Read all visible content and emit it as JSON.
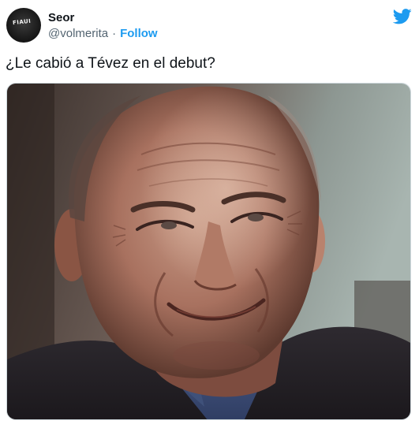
{
  "tweet": {
    "author": {
      "display_name": "Seor",
      "handle": "@volmerita",
      "avatar_text": "FIAUI"
    },
    "separator": "·",
    "follow_label": "Follow",
    "text": "¿Le cabió a Tévez en el debut?",
    "media": {
      "icon": "photo-image-smiling-man"
    }
  },
  "colors": {
    "brand": "#1d9bf0",
    "text_primary": "#0f1419",
    "text_secondary": "#536471"
  },
  "icons": {
    "logo": "twitter-bird-icon"
  }
}
